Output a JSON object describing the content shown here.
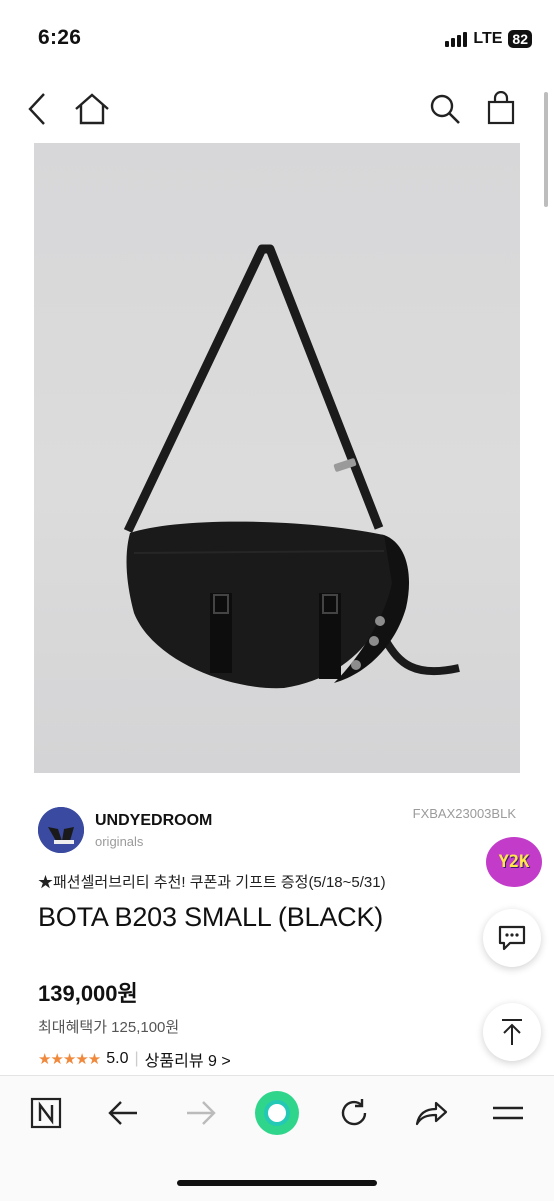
{
  "status_bar": {
    "time": "6:26",
    "network": "LTE",
    "battery": "82"
  },
  "nav": {
    "back_icon": "chevron-left-icon",
    "home_icon": "home-icon",
    "search_icon": "search-icon",
    "bag_icon": "shopping-bag-icon"
  },
  "brand": {
    "name": "UNDYEDROOM",
    "sub": "originals"
  },
  "product": {
    "code": "FXBAX23003BLK",
    "promo": "★패션셀러브리티 추천! 쿠폰과 기프트 증정(5/18~5/31)",
    "title": "BOTA B203 SMALL (BLACK)",
    "price": "139,000원",
    "max_benefit": "최대혜택가 125,100원",
    "stars": "★★★★★",
    "rating": "5.0",
    "review_link": "상품리뷰 9 >"
  },
  "floating": {
    "badge_text": "Y2K",
    "chat_icon": "chat-bubble-icon",
    "top_icon": "scroll-top-icon"
  },
  "toolbar": {
    "items": [
      "naver-n-icon",
      "arrow-left-icon",
      "arrow-right-icon",
      "green-dot-icon",
      "refresh-icon",
      "share-icon",
      "menu-icon"
    ]
  },
  "colors": {
    "accent_star": "#f0893c",
    "green": "#2fd58a",
    "badge": "#c23cc9"
  }
}
